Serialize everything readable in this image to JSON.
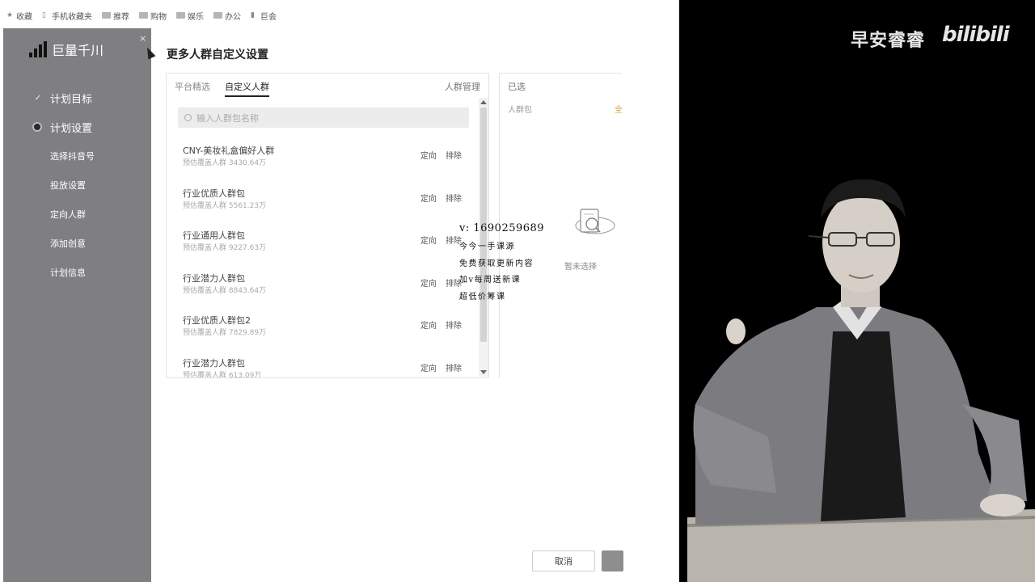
{
  "bookmarks": [
    {
      "label": "收藏",
      "icon": "star-icon"
    },
    {
      "label": "手机收藏夹",
      "icon": "phone-icon"
    },
    {
      "label": "推荐",
      "icon": "folder-icon"
    },
    {
      "label": "购物",
      "icon": "folder-icon"
    },
    {
      "label": "娱乐",
      "icon": "folder-icon"
    },
    {
      "label": "办公",
      "icon": "folder-icon"
    },
    {
      "label": "巨会",
      "icon": "page-icon"
    }
  ],
  "sidebar": {
    "logo": "巨量千川",
    "close": "×",
    "items": [
      {
        "label": "计划目标",
        "mark": "✓"
      },
      {
        "label": "计划设置"
      }
    ],
    "sub_items": [
      "选择抖音号",
      "投放设置",
      "定向人群",
      "添加创意",
      "计划信息"
    ]
  },
  "panel": {
    "title": "更多人群自定义设置",
    "tabs": [
      "平台精选",
      "自定义人群"
    ],
    "manage": "人群管理",
    "search_placeholder": "输入人群包名称",
    "rows": [
      {
        "name": "CNY-美妆礼盒偏好人群",
        "meta": "预估覆盖人群 3430.64万",
        "a1": "定向",
        "a2": "排除"
      },
      {
        "name": "行业优质人群包",
        "meta": "预估覆盖人群 5561.23万",
        "a1": "定向",
        "a2": "排除"
      },
      {
        "name": "行业通用人群包",
        "meta": "预估覆盖人群 9227.63万",
        "a1": "定向",
        "a2": "排除"
      },
      {
        "name": "行业潜力人群包",
        "meta": "预估覆盖人群 8843.64万",
        "a1": "定向",
        "a2": "排除"
      },
      {
        "name": "行业优质人群包2",
        "meta": "预估覆盖人群 7829.89万",
        "a1": "定向",
        "a2": "排除"
      },
      {
        "name": "行业潜力人群包",
        "meta": "预估覆盖人群 613.09万",
        "a1": "定向",
        "a2": "排除"
      }
    ],
    "selected_title": "已选",
    "selected_pack": "人群包",
    "selected_all": "全",
    "empty_text": "暂未选择",
    "cancel": "取消"
  },
  "overlay": {
    "vline": "v: 1690259689",
    "lines": [
      "今今一手课源",
      "免费获取更新内容",
      "加v每周送新课",
      "超低价筹课"
    ]
  },
  "webcam": {
    "brand": "早安睿睿",
    "bili": "bilibili"
  }
}
